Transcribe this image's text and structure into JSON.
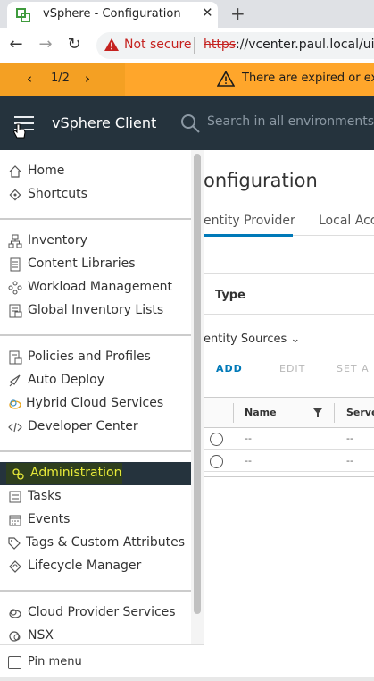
{
  "browser": {
    "tab_title": "vSphere - Configuration",
    "close_glyph": "✕",
    "new_tab_glyph": "+",
    "back_glyph": "←",
    "forward_glyph": "→",
    "reload_glyph": "↻",
    "security_label": "Not secure",
    "url_scheme": "https",
    "url_rest": "://vcenter.paul.local/ui/"
  },
  "banner": {
    "prev_glyph": "‹",
    "next_glyph": "›",
    "page_indicator": "1/2",
    "message": "There are expired or exp"
  },
  "header": {
    "app_title": "vSphere Client",
    "search_placeholder": "Search in all environments"
  },
  "content": {
    "page_title": "onfiguration",
    "tab_active": "entity Provider",
    "tab_other": "Local Acc",
    "type_header": "Type",
    "identity_sources": "entity Sources ⌄",
    "actions": {
      "add": "ADD",
      "edit": "EDIT",
      "set": "SET A"
    },
    "grid": {
      "col_name": "Name",
      "col_server": "Serve",
      "rows": [
        {
          "name": "--",
          "server": "--"
        },
        {
          "name": "--",
          "server": "--"
        }
      ]
    }
  },
  "sidebar": {
    "items": [
      {
        "label": "Home",
        "icon": "home-icon"
      },
      {
        "label": "Shortcuts",
        "icon": "shortcuts-icon"
      },
      {
        "label": "Inventory",
        "icon": "inventory-icon"
      },
      {
        "label": "Content Libraries",
        "icon": "library-icon"
      },
      {
        "label": "Workload Management",
        "icon": "workload-icon"
      },
      {
        "label": "Global Inventory Lists",
        "icon": "list-icon"
      },
      {
        "label": "Policies and Profiles",
        "icon": "policies-icon"
      },
      {
        "label": "Auto Deploy",
        "icon": "auto-deploy-icon"
      },
      {
        "label": "Hybrid Cloud Services",
        "icon": "hybrid-cloud-icon"
      },
      {
        "label": "Developer Center",
        "icon": "code-icon"
      },
      {
        "label": "Administration",
        "icon": "administration-icon",
        "active": true
      },
      {
        "label": "Tasks",
        "icon": "tasks-icon"
      },
      {
        "label": "Events",
        "icon": "events-icon"
      },
      {
        "label": "Tags & Custom Attributes",
        "icon": "tag-icon"
      },
      {
        "label": "Lifecycle Manager",
        "icon": "lifecycle-icon"
      },
      {
        "label": "Cloud Provider Services",
        "icon": "cloud-provider-icon"
      },
      {
        "label": "NSX",
        "icon": "nsx-icon"
      }
    ],
    "pin_label": "Pin menu"
  },
  "colors": {
    "header_bg": "#25333d",
    "banner_bg": "#ffa62b",
    "active_item_bg": "#25333d",
    "active_item_text": "#e7ea3a",
    "accent": "#0079b8"
  }
}
